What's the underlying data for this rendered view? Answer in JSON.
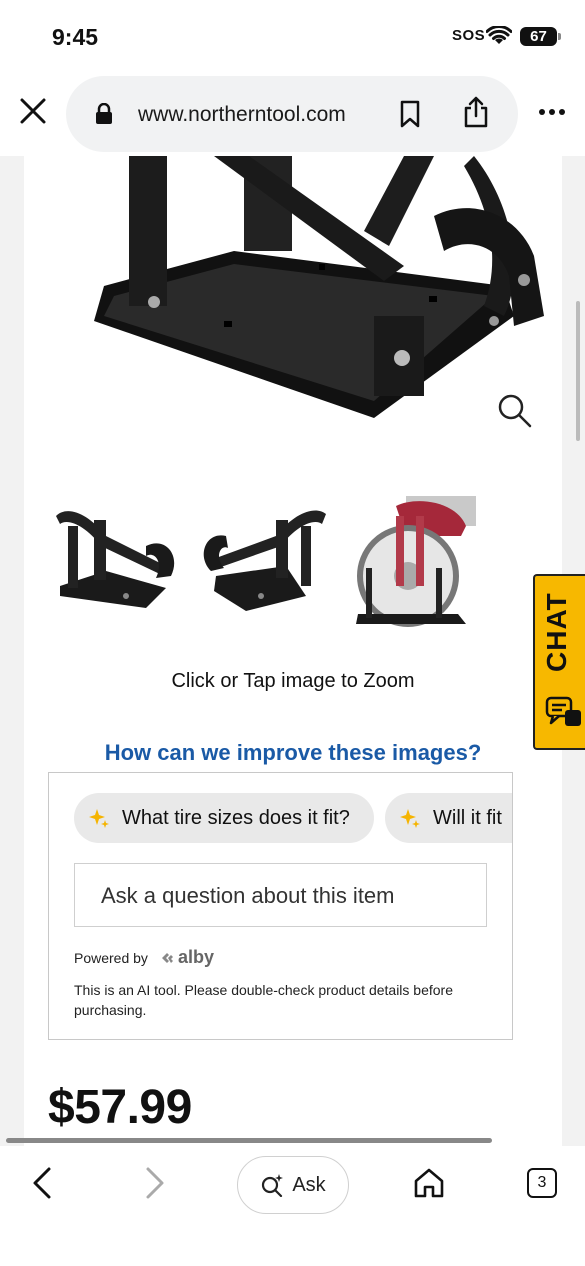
{
  "status_bar": {
    "time": "9:45",
    "sos": "SOS",
    "battery": "67"
  },
  "browser": {
    "url": "www.northerntool.com",
    "icons": [
      "close-icon",
      "lock-icon",
      "bookmark-icon",
      "share-icon",
      "more-icon"
    ]
  },
  "product": {
    "zoom_hint": "Click or Tap image to Zoom",
    "improve_link": "How can we improve these images?",
    "price": "$57.99"
  },
  "ai_assistant": {
    "chips": [
      "What tire sizes does it fit?",
      "Will it fit"
    ],
    "input_placeholder": "Ask a question about this item",
    "powered_by": "Powered by",
    "brand": "alby",
    "disclaimer": "This is an AI tool. Please double-check product details before purchasing."
  },
  "chat_tab": {
    "label": "CHAT",
    "color": "#f7b800"
  },
  "bottom_bar": {
    "ask_label": "Ask",
    "tab_count": "3"
  },
  "colors": {
    "link": "#1a5aa6",
    "chip_bg": "#e9e9e9",
    "chat": "#f7b800"
  }
}
